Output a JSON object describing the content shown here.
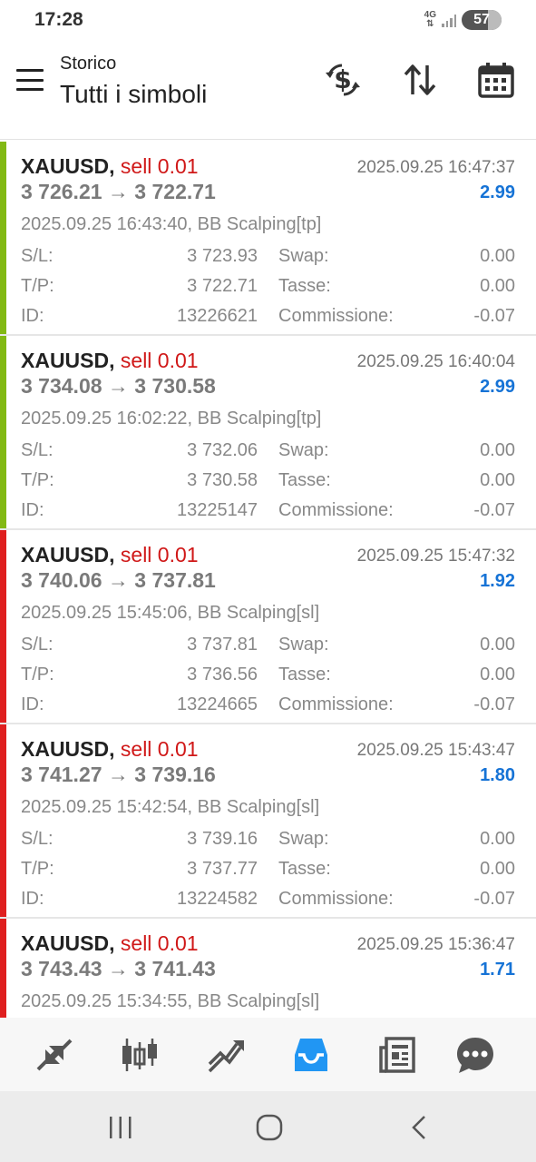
{
  "status_bar": {
    "time": "17:28",
    "network": "4G",
    "battery": "57"
  },
  "header": {
    "subtitle": "Storico",
    "title": "Tutti i simboli"
  },
  "colors": {
    "profit_bar": "#82b914",
    "loss_bar": "#df1f1f",
    "side": "#d01818",
    "profit": "#1673d6",
    "active_nav": "#2196f3"
  },
  "deals": [
    {
      "symbol": "XAUUSD,",
      "side": "sell 0.01",
      "close_time": "2025.09.25 16:47:37",
      "prices": "3 726.21 → 3 722.71",
      "profit": "2.99",
      "open_info": "2025.09.25 16:43:40, BB Scalping[tp]",
      "sl": "3 723.93",
      "tp": "3 722.71",
      "id": "13226621",
      "swap": "0.00",
      "taxes": "0.00",
      "commission": "-0.07",
      "result": "tp"
    },
    {
      "symbol": "XAUUSD,",
      "side": "sell 0.01",
      "close_time": "2025.09.25 16:40:04",
      "prices": "3 734.08 → 3 730.58",
      "profit": "2.99",
      "open_info": "2025.09.25 16:02:22, BB Scalping[tp]",
      "sl": "3 732.06",
      "tp": "3 730.58",
      "id": "13225147",
      "swap": "0.00",
      "taxes": "0.00",
      "commission": "-0.07",
      "result": "tp"
    },
    {
      "symbol": "XAUUSD,",
      "side": "sell 0.01",
      "close_time": "2025.09.25 15:47:32",
      "prices": "3 740.06 → 3 737.81",
      "profit": "1.92",
      "open_info": "2025.09.25 15:45:06, BB Scalping[sl]",
      "sl": "3 737.81",
      "tp": "3 736.56",
      "id": "13224665",
      "swap": "0.00",
      "taxes": "0.00",
      "commission": "-0.07",
      "result": "sl"
    },
    {
      "symbol": "XAUUSD,",
      "side": "sell 0.01",
      "close_time": "2025.09.25 15:43:47",
      "prices": "3 741.27 → 3 739.16",
      "profit": "1.80",
      "open_info": "2025.09.25 15:42:54, BB Scalping[sl]",
      "sl": "3 739.16",
      "tp": "3 737.77",
      "id": "13224582",
      "swap": "0.00",
      "taxes": "0.00",
      "commission": "-0.07",
      "result": "sl"
    },
    {
      "symbol": "XAUUSD,",
      "side": "sell 0.01",
      "close_time": "2025.09.25 15:36:47",
      "prices": "3 743.43 → 3 741.43",
      "profit": "1.71",
      "open_info": "2025.09.25 15:34:55, BB Scalping[sl]",
      "result": "sl"
    }
  ],
  "labels": {
    "sl": "S/L:",
    "tp": "T/P:",
    "id": "ID:",
    "swap": "Swap:",
    "taxes": "Tasse:",
    "commission": "Commissione:"
  },
  "bottom_nav": [
    {
      "icon": "quotes-icon"
    },
    {
      "icon": "chart-icon"
    },
    {
      "icon": "trade-icon"
    },
    {
      "icon": "history-icon",
      "active": true
    },
    {
      "icon": "news-icon"
    },
    {
      "icon": "chat-icon"
    }
  ]
}
